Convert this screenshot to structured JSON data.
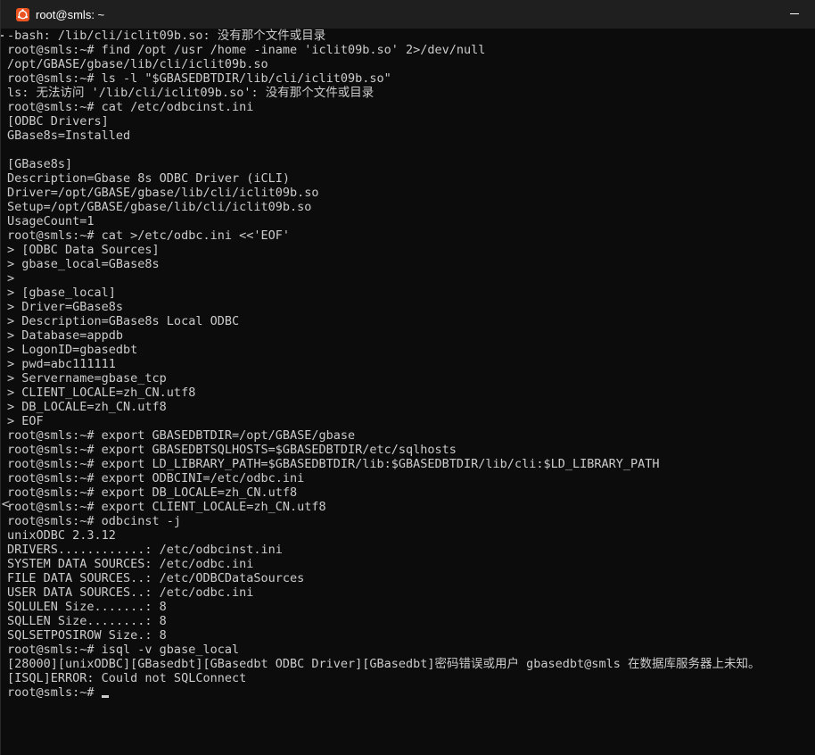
{
  "window": {
    "title": "root@smls: ~"
  },
  "terminal": {
    "lines": [
      "-bash: /lib/cli/iclit09b.so: 没有那个文件或目录",
      "root@smls:~# find /opt /usr /home -iname 'iclit09b.so' 2>/dev/null",
      "/opt/GBASE/gbase/lib/cli/iclit09b.so",
      "root@smls:~# ls -l \"$GBASEDBTDIR/lib/cli/iclit09b.so\"",
      "ls: 无法访问 '/lib/cli/iclit09b.so': 没有那个文件或目录",
      "root@smls:~# cat /etc/odbcinst.ini",
      "[ODBC Drivers]",
      "GBase8s=Installed",
      "",
      "[GBase8s]",
      "Description=Gbase 8s ODBC Driver (iCLI)",
      "Driver=/opt/GBASE/gbase/lib/cli/iclit09b.so",
      "Setup=/opt/GBASE/gbase/lib/cli/iclit09b.so",
      "UsageCount=1",
      "root@smls:~# cat >/etc/odbc.ini <<'EOF'",
      "> [ODBC Data Sources]",
      "> gbase_local=GBase8s",
      ">",
      "> [gbase_local]",
      "> Driver=GBase8s",
      "> Description=GBase8s Local ODBC",
      "> Database=appdb",
      "> LogonID=gbasedbt",
      "> pwd=abc111111",
      "> Servername=gbase_tcp",
      "> CLIENT_LOCALE=zh_CN.utf8",
      "> DB_LOCALE=zh_CN.utf8",
      "> EOF",
      "root@smls:~# export GBASEDBTDIR=/opt/GBASE/gbase",
      "root@smls:~# export GBASEDBTSQLHOSTS=$GBASEDBTDIR/etc/sqlhosts",
      "root@smls:~# export LD_LIBRARY_PATH=$GBASEDBTDIR/lib:$GBASEDBTDIR/lib/cli:$LD_LIBRARY_PATH",
      "root@smls:~# export ODBCINI=/etc/odbc.ini",
      "root@smls:~# export DB_LOCALE=zh_CN.utf8",
      "root@smls:~# export CLIENT_LOCALE=zh_CN.utf8",
      "root@smls:~# odbcinst -j",
      "unixODBC 2.3.12",
      "DRIVERS............: /etc/odbcinst.ini",
      "SYSTEM DATA SOURCES: /etc/odbc.ini",
      "FILE DATA SOURCES..: /etc/ODBCDataSources",
      "USER DATA SOURCES..: /etc/odbc.ini",
      "SQLULEN Size.......: 8",
      "SQLLEN Size........: 8",
      "SQLSETPOSIROW Size.: 8",
      "root@smls:~# isql -v gbase_local",
      "[28000][unixODBC][GBasedbt][GBasedbt ODBC Driver][GBasedbt]密码错误或用户 gbasedbt@smls 在数据库服务器上未知。",
      "[ISQL]ERROR: Could not SQLConnect"
    ],
    "prompt": "root@smls:~# ",
    "left_glyph": "<"
  },
  "icons": {
    "app": "ubuntu-terminal-icon",
    "minimize": "minimize-icon",
    "cursor": "block-cursor"
  },
  "colors": {
    "background": "#0c0c0c",
    "titlebar": "#1f1f1f",
    "text": "#cccccc",
    "accent": "#e95420"
  }
}
